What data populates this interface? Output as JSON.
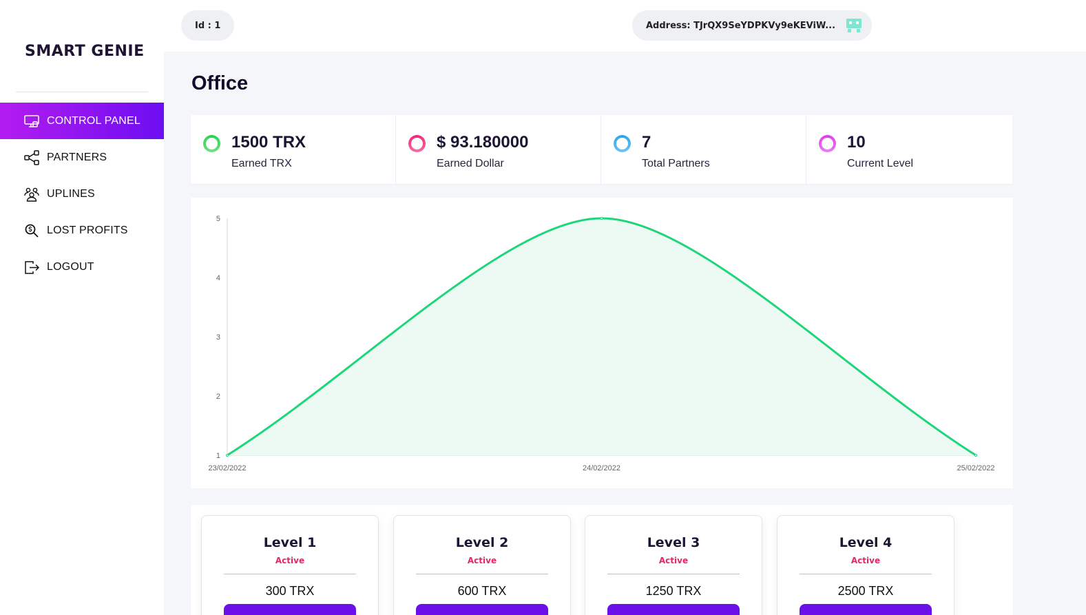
{
  "brand": {
    "logo_text": "SMART GENIE"
  },
  "header": {
    "id_label": "Id : 1",
    "address_label": "Address: TJrQX9SeYDPKVy9eKEViW..."
  },
  "sidebar": {
    "items": [
      {
        "label": "CONTROL PANEL",
        "icon": "monitor-icon",
        "active": true
      },
      {
        "label": "PARTNERS",
        "icon": "share-icon",
        "active": false
      },
      {
        "label": "UPLINES",
        "icon": "users-icon",
        "active": false
      },
      {
        "label": "LOST PROFITS",
        "icon": "search-dollar-icon",
        "active": false
      },
      {
        "label": "LOGOUT",
        "icon": "logout-icon",
        "active": false
      }
    ]
  },
  "page": {
    "title": "Office"
  },
  "stats": [
    {
      "value": "1500 TRX",
      "label": "Earned TRX",
      "ring": "#27d34a"
    },
    {
      "value": "$ 93.180000",
      "label": "Earned Dollar",
      "ring": "#f0267a"
    },
    {
      "value": "7",
      "label": "Total Partners",
      "ring": "#27a7e8"
    },
    {
      "value": "10",
      "label": "Current Level",
      "ring": "#e03af0"
    }
  ],
  "colors": {
    "accent": "#7a12ee",
    "chart_line": "#1ed67a",
    "chart_fill": "#ecfaf3",
    "status_active": "#e8246b"
  },
  "chart_data": {
    "type": "area",
    "categories": [
      "23/02/2022",
      "24/02/2022",
      "25/02/2022"
    ],
    "values": [
      1,
      5,
      1
    ],
    "title": "",
    "xlabel": "",
    "ylabel": "",
    "ylim": [
      1,
      5
    ],
    "yticks": [
      1,
      2,
      3,
      4,
      5
    ],
    "grid": false,
    "legend": "none"
  },
  "levels": [
    {
      "name": "Level 1",
      "status": "Active",
      "price": "300 TRX"
    },
    {
      "name": "Level 2",
      "status": "Active",
      "price": "600 TRX"
    },
    {
      "name": "Level 3",
      "status": "Active",
      "price": "1250 TRX"
    },
    {
      "name": "Level 4",
      "status": "Active",
      "price": "2500 TRX"
    }
  ]
}
